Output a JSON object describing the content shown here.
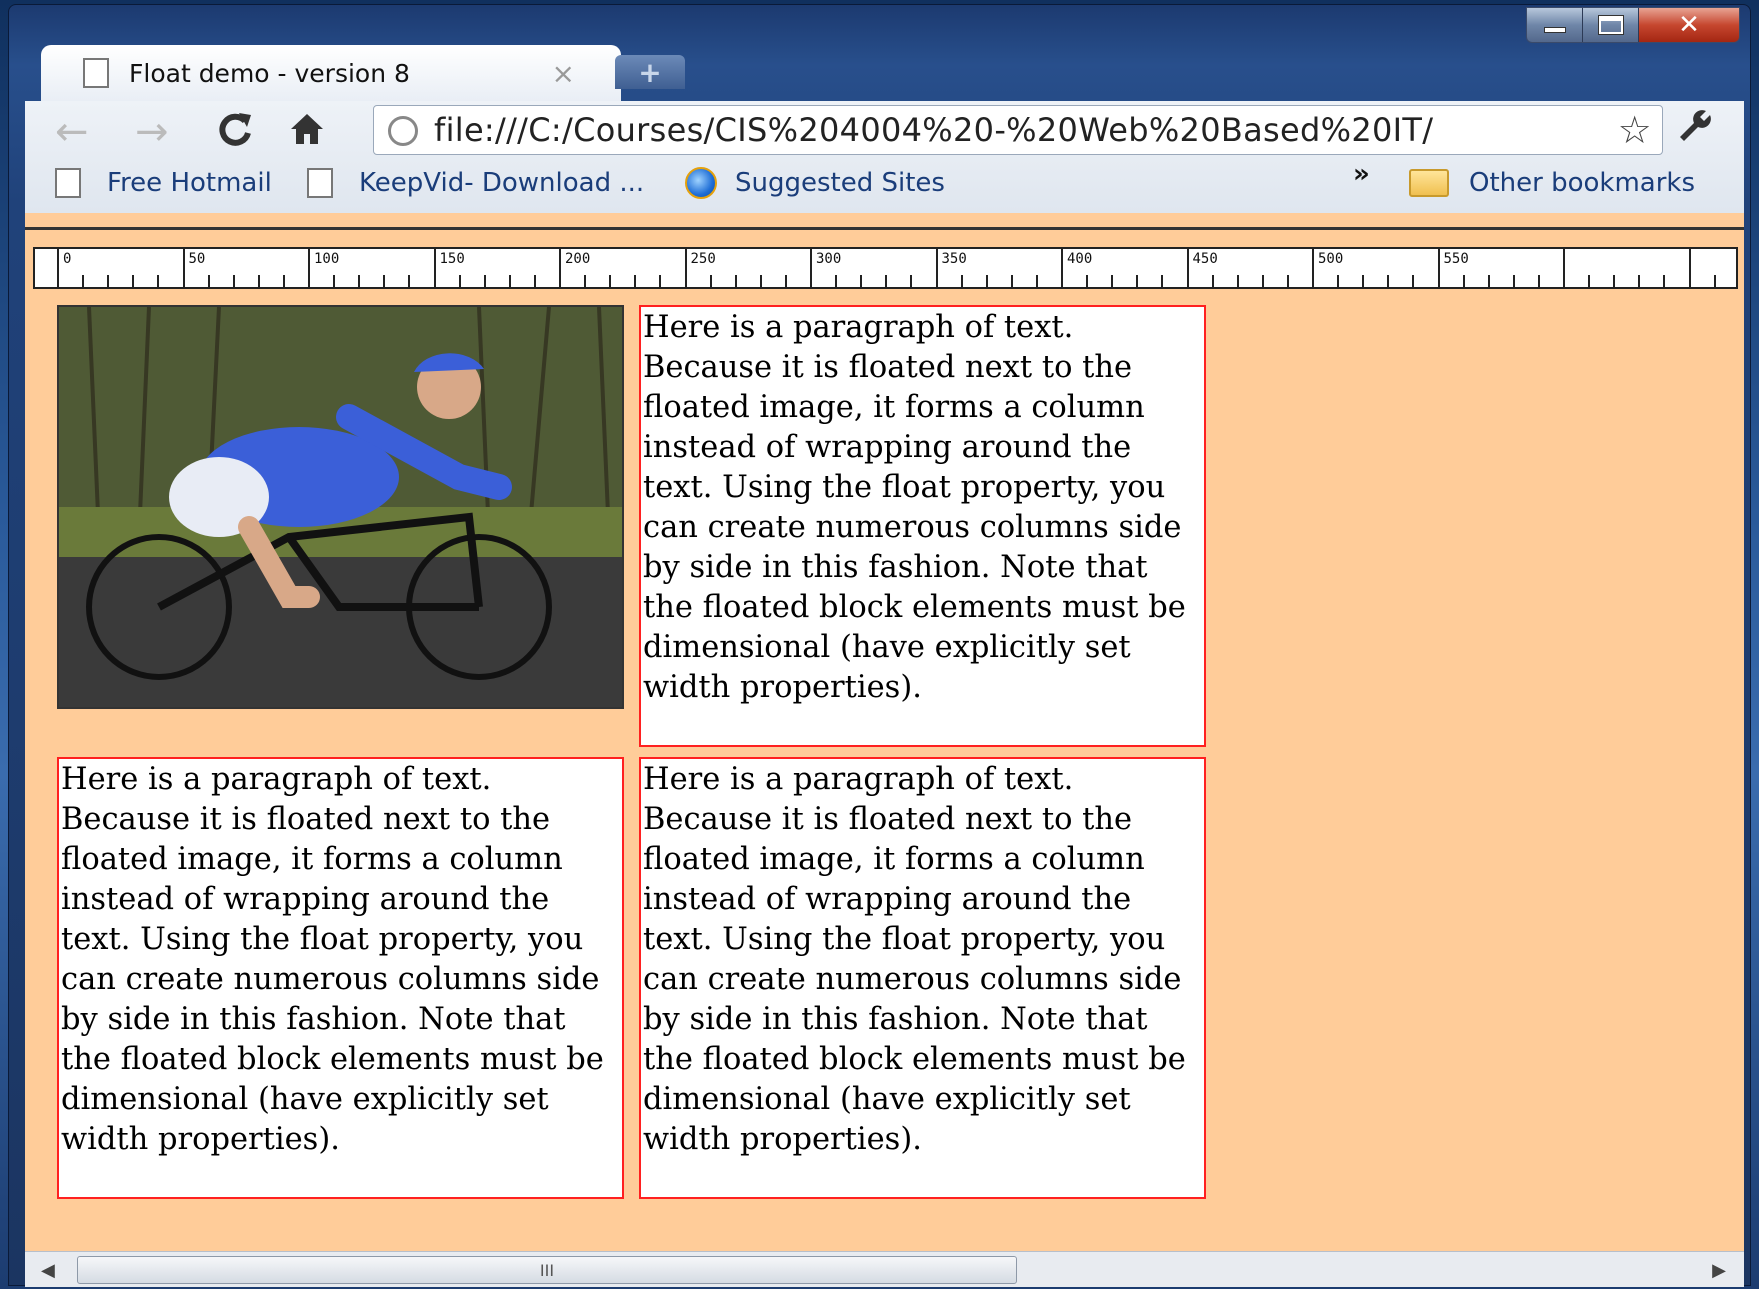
{
  "window": {
    "controls": {
      "close": "✕"
    }
  },
  "tab": {
    "title": "Float demo - version 8",
    "close": "×",
    "new_tab": "+"
  },
  "toolbar": {
    "back": "←",
    "forward": "→",
    "reload": "C",
    "home": "⌂",
    "address": "file:///C:/Courses/CIS%204004%20-%20Web%20Based%20IT/",
    "star": "☆",
    "wrench": "🔧"
  },
  "bookmarks": {
    "items": [
      {
        "label": "Free Hotmail",
        "icon": "page-icon"
      },
      {
        "label": "KeepVid- Download ...",
        "icon": "page-icon"
      },
      {
        "label": "Suggested Sites",
        "icon": "ie-icon"
      }
    ],
    "overflow": "»",
    "other": "Other bookmarks"
  },
  "ruler": {
    "labels": [
      "0",
      "50",
      "100",
      "150",
      "200",
      "250",
      "300",
      "350",
      "400",
      "450",
      "500",
      "550"
    ]
  },
  "paragraph_text": "Here is a paragraph of text. Because it is floated next to the floated image, it forms a column instead of wrapping around the text. Using the float property, you can create numerous columns side by side in this fashion. Note that the floated block elements must be dimensional (have explicitly set width properties).",
  "paragraphs": {
    "p1": "Here is a paragraph of text. Because it is floated next to the floated image, it forms a column instead of wrapping around the text. Using the float property, you can create numerous columns side by side in this fashion. Note that the floated block elements must be dimensional (have explicitly set width properties).",
    "p2": "Here is a paragraph of text. Because it is floated next to the floated image, it forms a column instead of wrapping around the text. Using the float property, you can create numerous columns side by side in this fashion. Note that the floated block elements must be dimensional (have explicitly set width properties).",
    "p3": "Here is a paragraph of text. Because it is floated next to the floated image, it forms a column instead of wrapping around the text. Using the float property, you can create numerous columns side by side in this fashion. Note that the floated block elements must be dimensional (have explicitly set width properties)."
  },
  "scrollbar": {
    "grip": "III",
    "left": "◀",
    "right": "▶"
  },
  "colors": {
    "page_background": "#ffcc99",
    "box_border": "#ff2020"
  }
}
